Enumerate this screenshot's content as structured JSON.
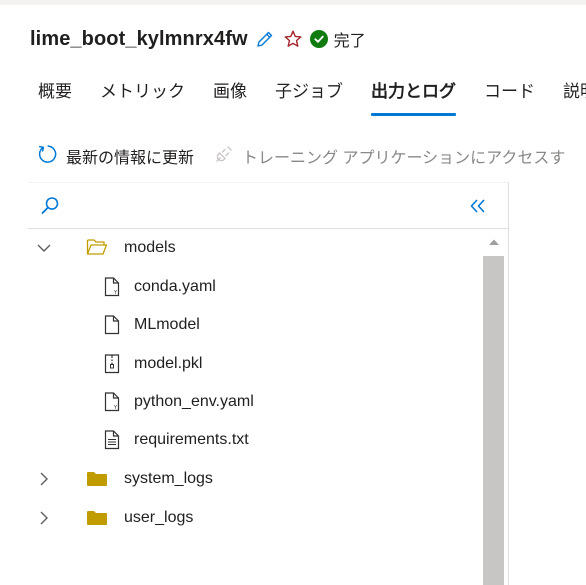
{
  "header": {
    "run_name": "lime_boot_kylmnrx4fw",
    "edit_icon": "pencil-icon",
    "favorite_icon": "star-outline-icon",
    "status": {
      "label": "完了",
      "icon": "check-circle-icon",
      "color": "#107c10"
    }
  },
  "tabs": [
    {
      "label": "概要",
      "active": false
    },
    {
      "label": "メトリック",
      "active": false
    },
    {
      "label": "画像",
      "active": false
    },
    {
      "label": "子ジョブ",
      "active": false
    },
    {
      "label": "出力とログ",
      "active": true
    },
    {
      "label": "コード",
      "active": false
    },
    {
      "label": "説明",
      "active": false
    }
  ],
  "toolbar": {
    "refresh_label": "最新の情報に更新",
    "refresh_icon": "refresh-icon",
    "training_app_label": "トレーニング アプリケーションにアクセスす",
    "training_app_icon": "plug-icon",
    "training_app_enabled": false
  },
  "file_tree": {
    "search_icon": "search-icon",
    "collapse_icon": "double-chevron-left-icon",
    "items": [
      {
        "label": "models",
        "type": "folder",
        "expanded": true,
        "depth": 0,
        "icon": "folder-open-icon"
      },
      {
        "label": "conda.yaml",
        "type": "file",
        "depth": 1,
        "icon": "yaml-file-icon"
      },
      {
        "label": "MLmodel",
        "type": "file",
        "depth": 1,
        "icon": "file-icon"
      },
      {
        "label": "model.pkl",
        "type": "file",
        "depth": 1,
        "icon": "archive-file-icon"
      },
      {
        "label": "python_env.yaml",
        "type": "file",
        "depth": 1,
        "icon": "yaml-file-icon"
      },
      {
        "label": "requirements.txt",
        "type": "file",
        "depth": 1,
        "icon": "text-file-icon"
      },
      {
        "label": "system_logs",
        "type": "folder",
        "expanded": false,
        "depth": 0,
        "icon": "folder-icon"
      },
      {
        "label": "user_logs",
        "type": "folder",
        "expanded": false,
        "depth": 0,
        "icon": "folder-icon"
      }
    ]
  },
  "colors": {
    "accent": "#0078d4",
    "success": "#107c10",
    "favorite": "#a4262c",
    "folder": "#c19c00",
    "disabled_text": "#8a8886"
  }
}
